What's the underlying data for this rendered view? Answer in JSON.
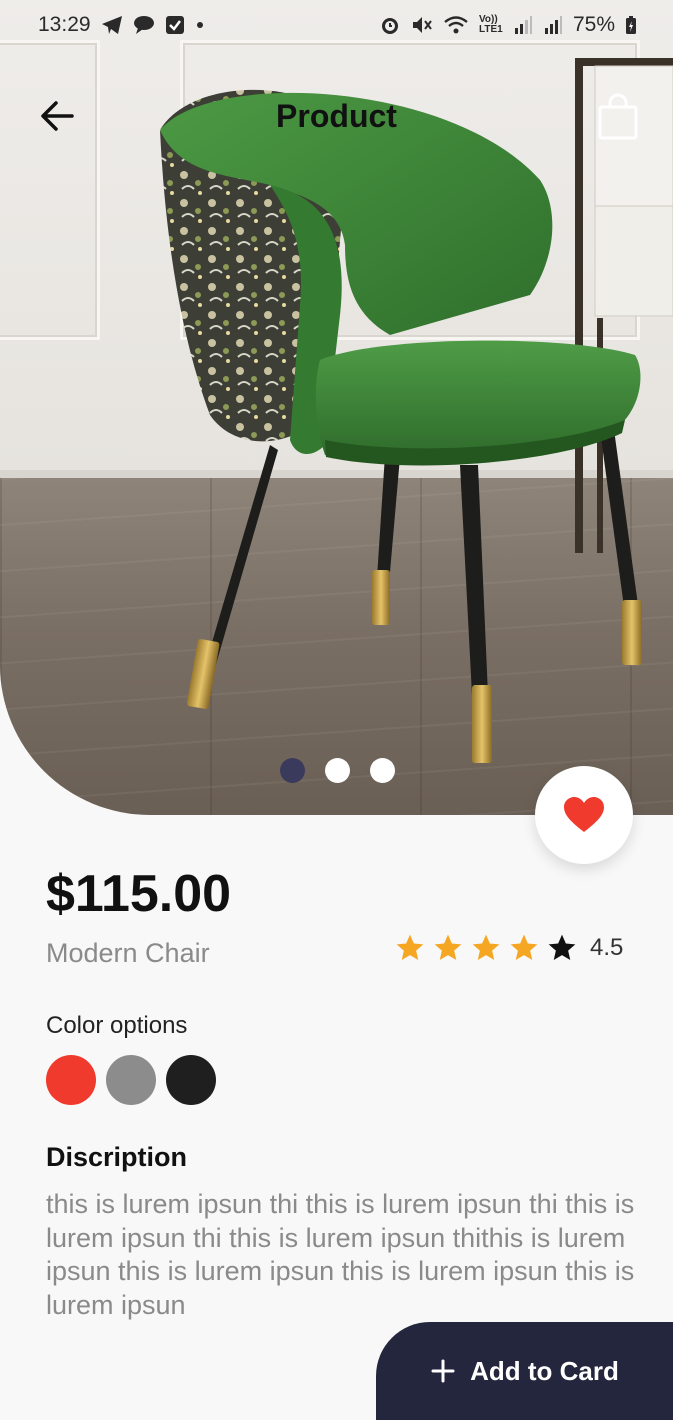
{
  "status_bar": {
    "time": "13:29",
    "battery": "75%",
    "left_icons": [
      "telegram-icon",
      "chat-icon",
      "check-square-icon",
      "dot-icon"
    ],
    "right_icons": [
      "alarm-icon",
      "mute-icon",
      "wifi-icon",
      "volte-icon",
      "signal-icon",
      "signal-icon",
      "battery-icon"
    ],
    "volte_label": "Vo)) LTE1"
  },
  "app_bar": {
    "title": "Product",
    "back_icon": "arrow-left-icon",
    "bag_icon": "shopping-bag-icon"
  },
  "carousel": {
    "count": 3,
    "active_index": 0
  },
  "product": {
    "price": "$115.00",
    "name": "Modern Chair",
    "rating_value": "4.5",
    "rating_stars": 4,
    "favorited": true
  },
  "colors": {
    "label": "Color options",
    "options": [
      "#f03a2e",
      "#8c8c8c",
      "#1f1f1f"
    ]
  },
  "description": {
    "title": "Discription",
    "text": "this is lurem ipsun thi this is lurem ipsun thi this is lurem ipsun thi this is lurem ipsun thithis is lurem ipsun this is lurem ipsun this is lurem ipsun this is lurem ipsun"
  },
  "cta": {
    "label": "Add to Card",
    "icon": "plus-icon"
  },
  "theme": {
    "accent_dark": "#24263d",
    "star_color": "#f5a623",
    "heart_color": "#f03a2e",
    "chair_green": "#3f8a3b"
  }
}
